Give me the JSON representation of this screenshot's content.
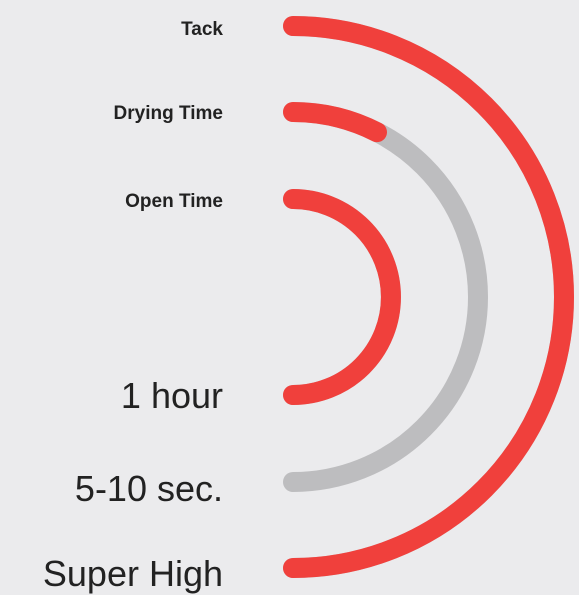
{
  "chart_data": {
    "type": "radial-bar",
    "series": [
      {
        "name": "Tack",
        "value_label": "Super High",
        "fraction": 1.0
      },
      {
        "name": "Drying Time",
        "value_label": "5-10 sec.",
        "fraction": 0.15
      },
      {
        "name": "Open Time",
        "value_label": "1 hour",
        "fraction": 1.0
      }
    ],
    "colors": {
      "fill": "#f0403c",
      "track": "#bdbdbf",
      "background": "#ebebed",
      "text": "#222222"
    }
  }
}
